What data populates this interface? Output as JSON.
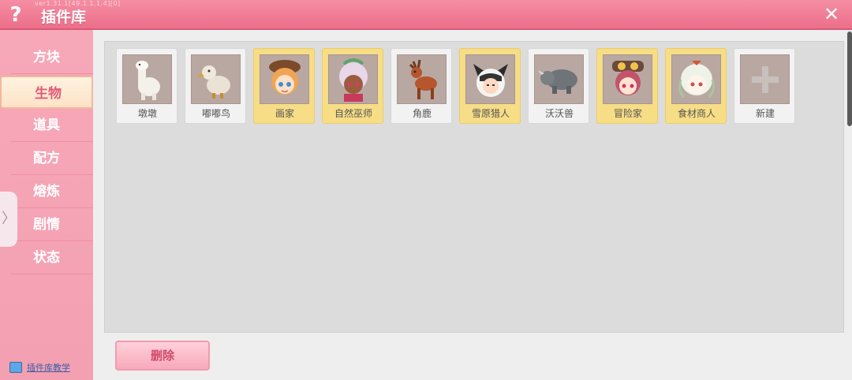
{
  "header": {
    "version": "ver1.31.1[49.1.1.1.4][0]",
    "title": "插件库",
    "help_icon": "question-icon",
    "close_icon": "close-icon"
  },
  "sidebar": {
    "items": [
      {
        "label": "方块",
        "active": false
      },
      {
        "label": "生物",
        "active": true
      },
      {
        "label": "道具",
        "active": false
      },
      {
        "label": "配方",
        "active": false
      },
      {
        "label": "熔炼",
        "active": false
      },
      {
        "label": "剧情",
        "active": false
      },
      {
        "label": "状态",
        "active": false
      }
    ],
    "expand_glyph": "〉",
    "tutorial_label": "插件库教学"
  },
  "cards": [
    {
      "label": "墩墩",
      "icon": "alpaca-icon",
      "highlighted": false
    },
    {
      "label": "嘟嘟鸟",
      "icon": "dodo-bird-icon",
      "highlighted": false
    },
    {
      "label": "画家",
      "icon": "painter-avatar-icon",
      "highlighted": true
    },
    {
      "label": "自然巫师",
      "icon": "nature-wizard-avatar-icon",
      "highlighted": true
    },
    {
      "label": "角鹿",
      "icon": "deer-icon",
      "highlighted": false
    },
    {
      "label": "雪原猎人",
      "icon": "snow-hunter-avatar-icon",
      "highlighted": true
    },
    {
      "label": "沃沃兽",
      "icon": "rhino-icon",
      "highlighted": false
    },
    {
      "label": "冒险家",
      "icon": "adventurer-avatar-icon",
      "highlighted": true
    },
    {
      "label": "食材商人",
      "icon": "merchant-avatar-icon",
      "highlighted": true
    },
    {
      "label": "新建",
      "icon": "plus-icon",
      "highlighted": false
    }
  ],
  "delete_label": "删除",
  "colors": {
    "header": "#ec6f8a",
    "sidebar": "#f5a3b5",
    "highlight_card": "#f6dd86",
    "panel": "#dcdcdc"
  }
}
